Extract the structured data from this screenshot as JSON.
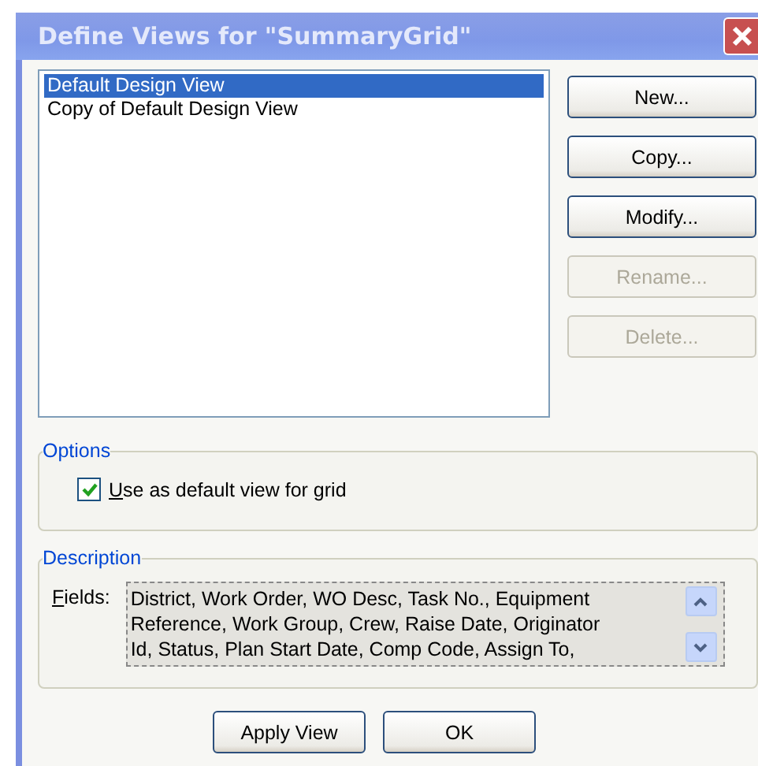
{
  "window": {
    "title": "Define Views for \"SummaryGrid\""
  },
  "views": [
    {
      "label": "Default Design View",
      "selected": true
    },
    {
      "label": "Copy of Default Design View",
      "selected": false
    }
  ],
  "side_buttons": [
    {
      "label": "New...",
      "disabled": false
    },
    {
      "label": "Copy...",
      "disabled": false
    },
    {
      "label": "Modify...",
      "disabled": false
    },
    {
      "label": "Rename...",
      "disabled": true
    },
    {
      "label": "Delete...",
      "disabled": true
    }
  ],
  "options": {
    "legend": "Options",
    "default_view": {
      "label": "Use as default view for grid",
      "checked": true
    }
  },
  "description": {
    "legend": "Description",
    "fields_label": "Fields:",
    "fields_lines": [
      "District, Work Order, WO Desc, Task No., Equipment",
      "Reference, Work Group, Crew, Raise Date, Originator",
      "Id, Status, Plan Start Date, Comp Code, Assign To,"
    ]
  },
  "buttons": [
    "Apply View",
    "OK"
  ]
}
